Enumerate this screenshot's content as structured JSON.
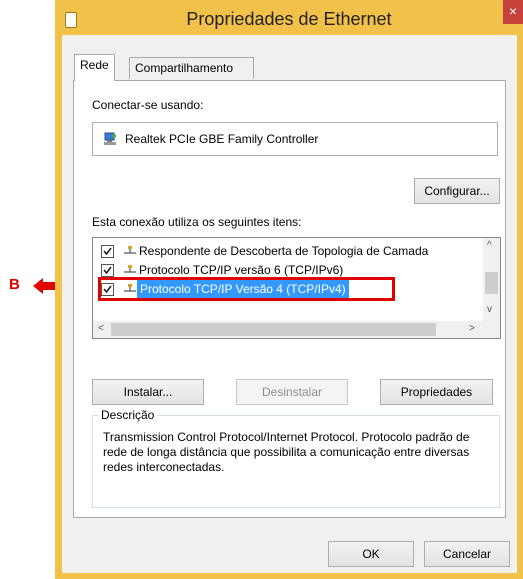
{
  "annotation": {
    "label": "B",
    "color": "#e00000"
  },
  "window": {
    "title": "Propriedades de Ethernet",
    "close_glyph": "×",
    "accent": "#f2c14a"
  },
  "tabs": [
    {
      "label": "Rede",
      "active": true
    },
    {
      "label": "Compartilhamento",
      "active": false
    }
  ],
  "connect": {
    "label": "Conectar-se usando:",
    "adapter": "Realtek PCIe GBE Family Controller",
    "adapter_icon": "network-adapter-icon",
    "configure_label": "Configurar..."
  },
  "items": {
    "label": "Esta conexão utiliza os seguintes itens:",
    "list": [
      {
        "text": "Respondente de Descoberta de Topologia de Camada",
        "checked": true,
        "selected": false,
        "icon": "protocol-icon"
      },
      {
        "text": "Protocolo TCP/IP versão 6 (TCP/IPv6)",
        "checked": true,
        "selected": false,
        "icon": "protocol-icon"
      },
      {
        "text": "Protocolo TCP/IP Versão 4 (TCP/IPv4)",
        "checked": true,
        "selected": true,
        "icon": "protocol-icon"
      }
    ],
    "selection_color": "#3399ff"
  },
  "actions": {
    "install": "Instalar...",
    "uninstall": "Desinstalar",
    "properties": "Propriedades"
  },
  "description": {
    "title": "Descrição",
    "text": "Transmission Control Protocol/Internet Protocol. Protocolo padrão de rede de longa distância que possibilita a comunicação entre diversas redes interconectadas."
  },
  "footer": {
    "ok": "OK",
    "cancel": "Cancelar"
  }
}
